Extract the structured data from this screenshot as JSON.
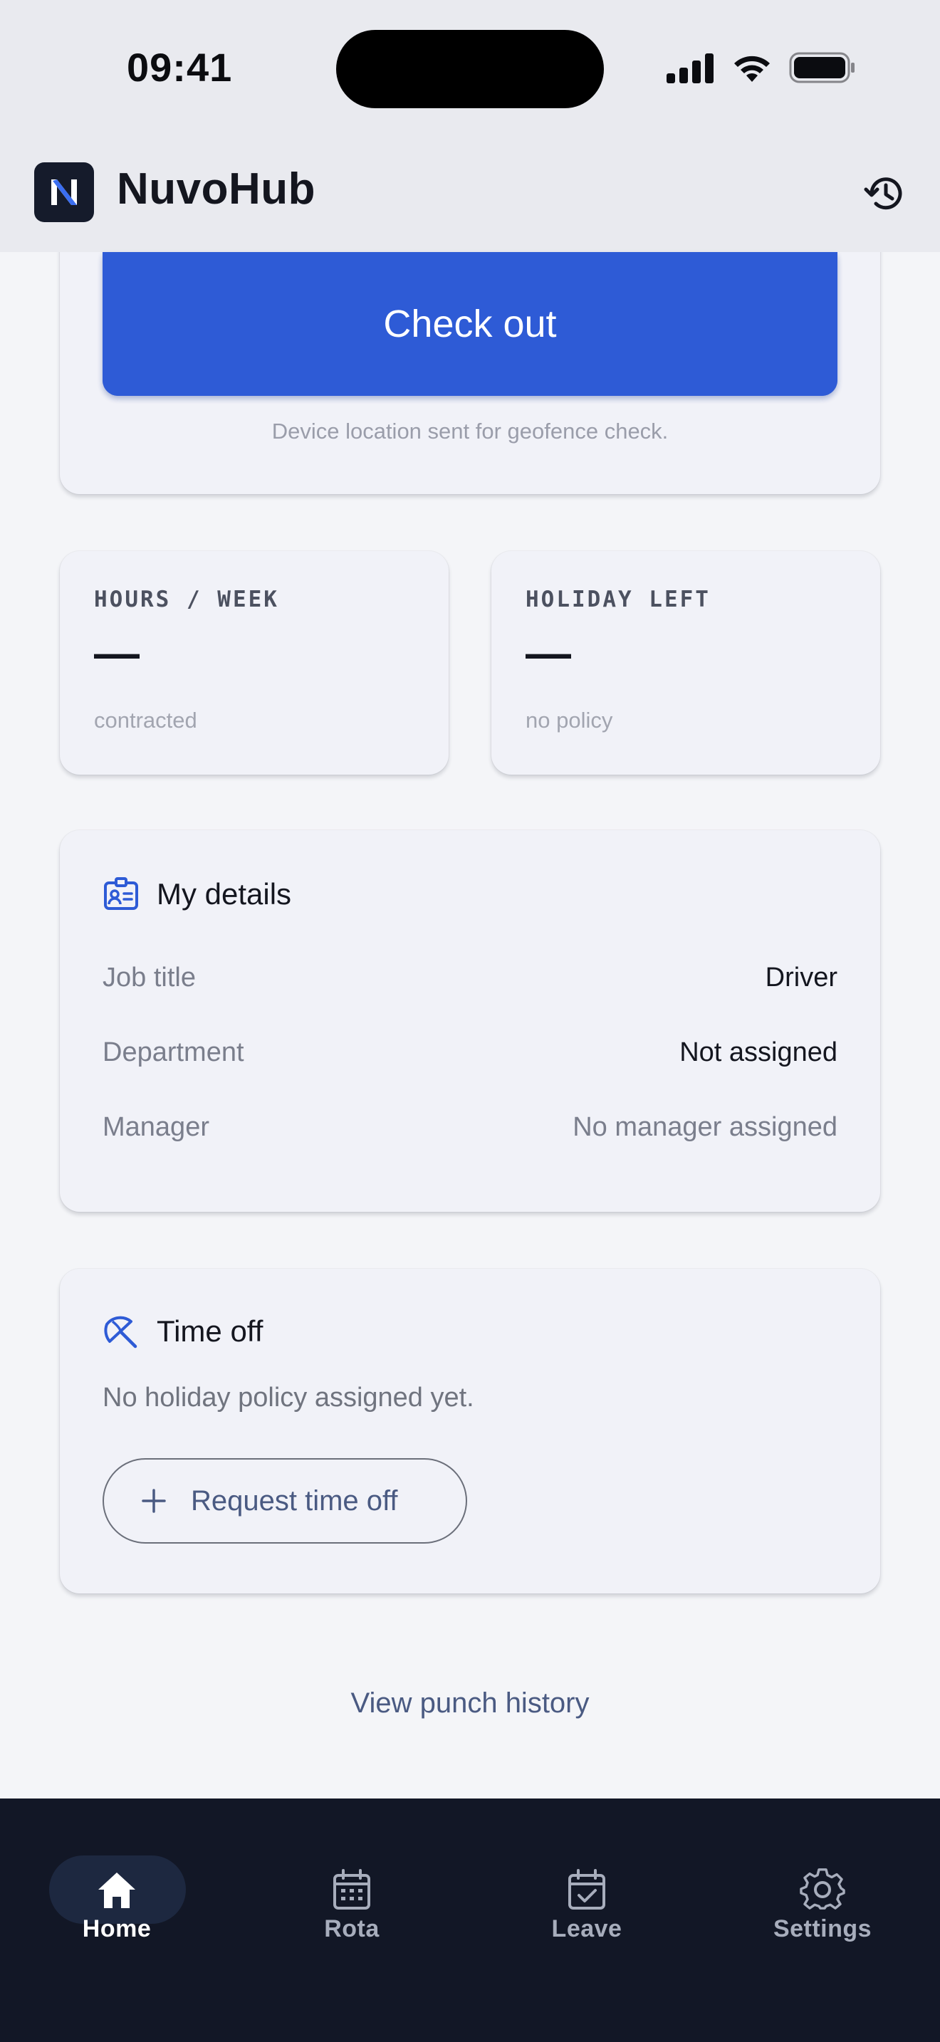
{
  "status_bar": {
    "time": "09:41"
  },
  "header": {
    "app_name": "NuvoHub",
    "logo_letter": "N"
  },
  "checkout": {
    "button_label": "Check out",
    "note": "Device location sent for geofence check."
  },
  "stats": [
    {
      "label": "HOURS / WEEK",
      "value": "—",
      "sub": "contracted"
    },
    {
      "label": "HOLIDAY LEFT",
      "value": "—",
      "sub": "no policy"
    }
  ],
  "details": {
    "title": "My details",
    "rows": [
      {
        "label": "Job title",
        "value": "Driver"
      },
      {
        "label": "Department",
        "value": "Not assigned"
      },
      {
        "label": "Manager",
        "value": "No manager assigned"
      }
    ]
  },
  "time_off": {
    "title": "Time off",
    "text": "No holiday policy assigned yet.",
    "button_label": "Request time off"
  },
  "view_history_label": "View punch history",
  "nav": {
    "items": [
      {
        "label": "Home",
        "icon": "home-icon",
        "active": true
      },
      {
        "label": "Rota",
        "icon": "calendar-icon",
        "active": false
      },
      {
        "label": "Leave",
        "icon": "calendar-check-icon",
        "active": false
      },
      {
        "label": "Settings",
        "icon": "gear-icon",
        "active": false
      }
    ]
  },
  "colors": {
    "accent": "#2e5bd6",
    "nav_background": "#121726",
    "header_background": "#e9eaef",
    "link": "#4a5a82"
  }
}
